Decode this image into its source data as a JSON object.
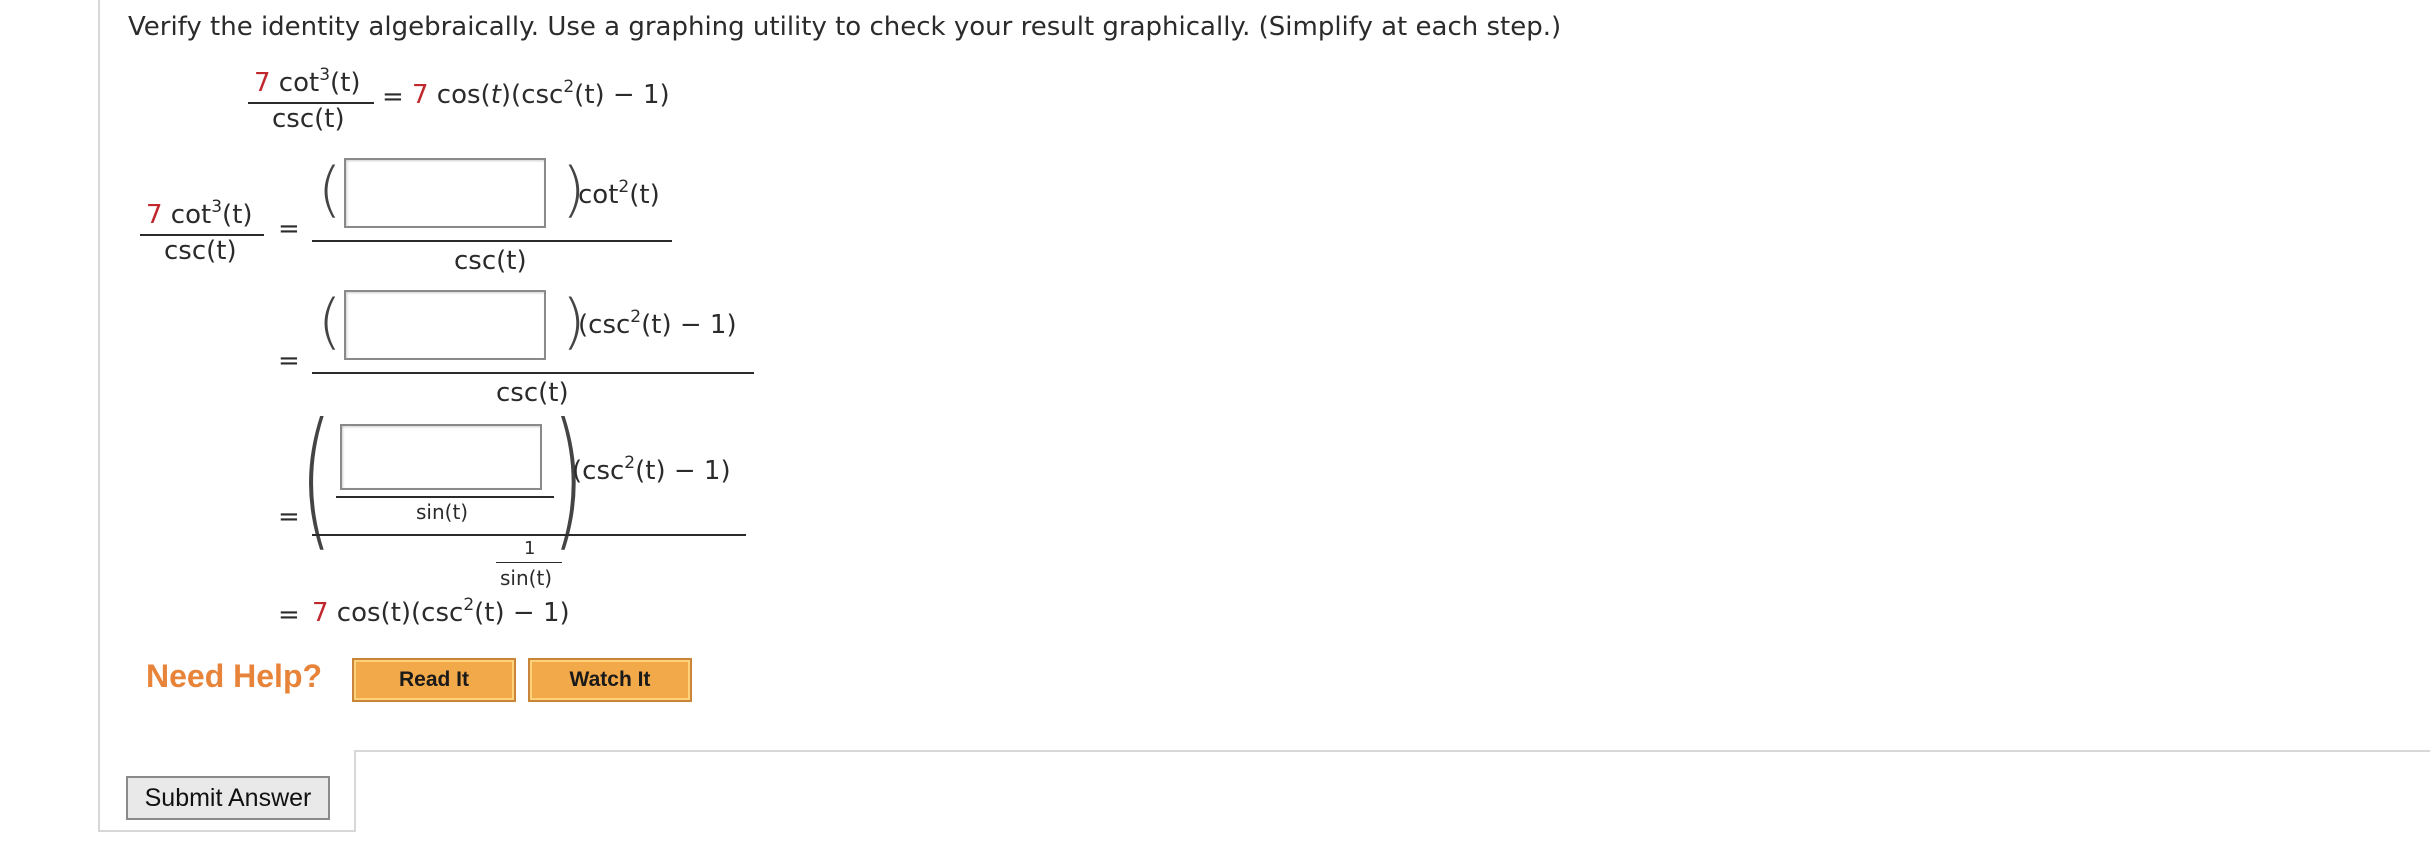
{
  "instruction": "Verify the identity algebraically. Use a graphing utility to check your result graphically. (Simplify at each step.)",
  "identity": {
    "lhs_coef": "7",
    "lhs_num_fn": " cot",
    "lhs_num_exp": "3",
    "lhs_num_arg": "(t)",
    "lhs_den": "csc(t)",
    "equals": "=",
    "rhs_coef": "7",
    "rhs_rest_a": " cos(",
    "rhs_var": "t",
    "rhs_rest_b": ")(csc",
    "rhs_exp": "2",
    "rhs_rest_c": "(t) − 1)"
  },
  "steps": {
    "step1": {
      "factor_fn": "cot",
      "factor_exp": "2",
      "factor_arg": "(t)",
      "den": "csc(t)",
      "answer": ""
    },
    "step2": {
      "factor": "(csc",
      "factor_exp": "2",
      "factor_rest": "(t) − 1)",
      "den": "csc(t)",
      "answer": ""
    },
    "step3": {
      "inner_den": "sin(t)",
      "factor": "(csc",
      "factor_exp": "2",
      "factor_rest": "(t) − 1)",
      "outer_num": "1",
      "outer_den": "sin(t)",
      "answer": ""
    },
    "final": {
      "coef": "7",
      "rest_a": " cos(t)(csc",
      "exp": "2",
      "rest_b": "(t) − 1)"
    }
  },
  "help": {
    "label": "Need Help?",
    "read_it": "Read It",
    "watch_it": "Watch It"
  },
  "submit_label": "Submit Answer",
  "colors": {
    "accent_red": "#c0282d",
    "help_orange": "#e8833a",
    "button_orange": "#f2a94a"
  }
}
